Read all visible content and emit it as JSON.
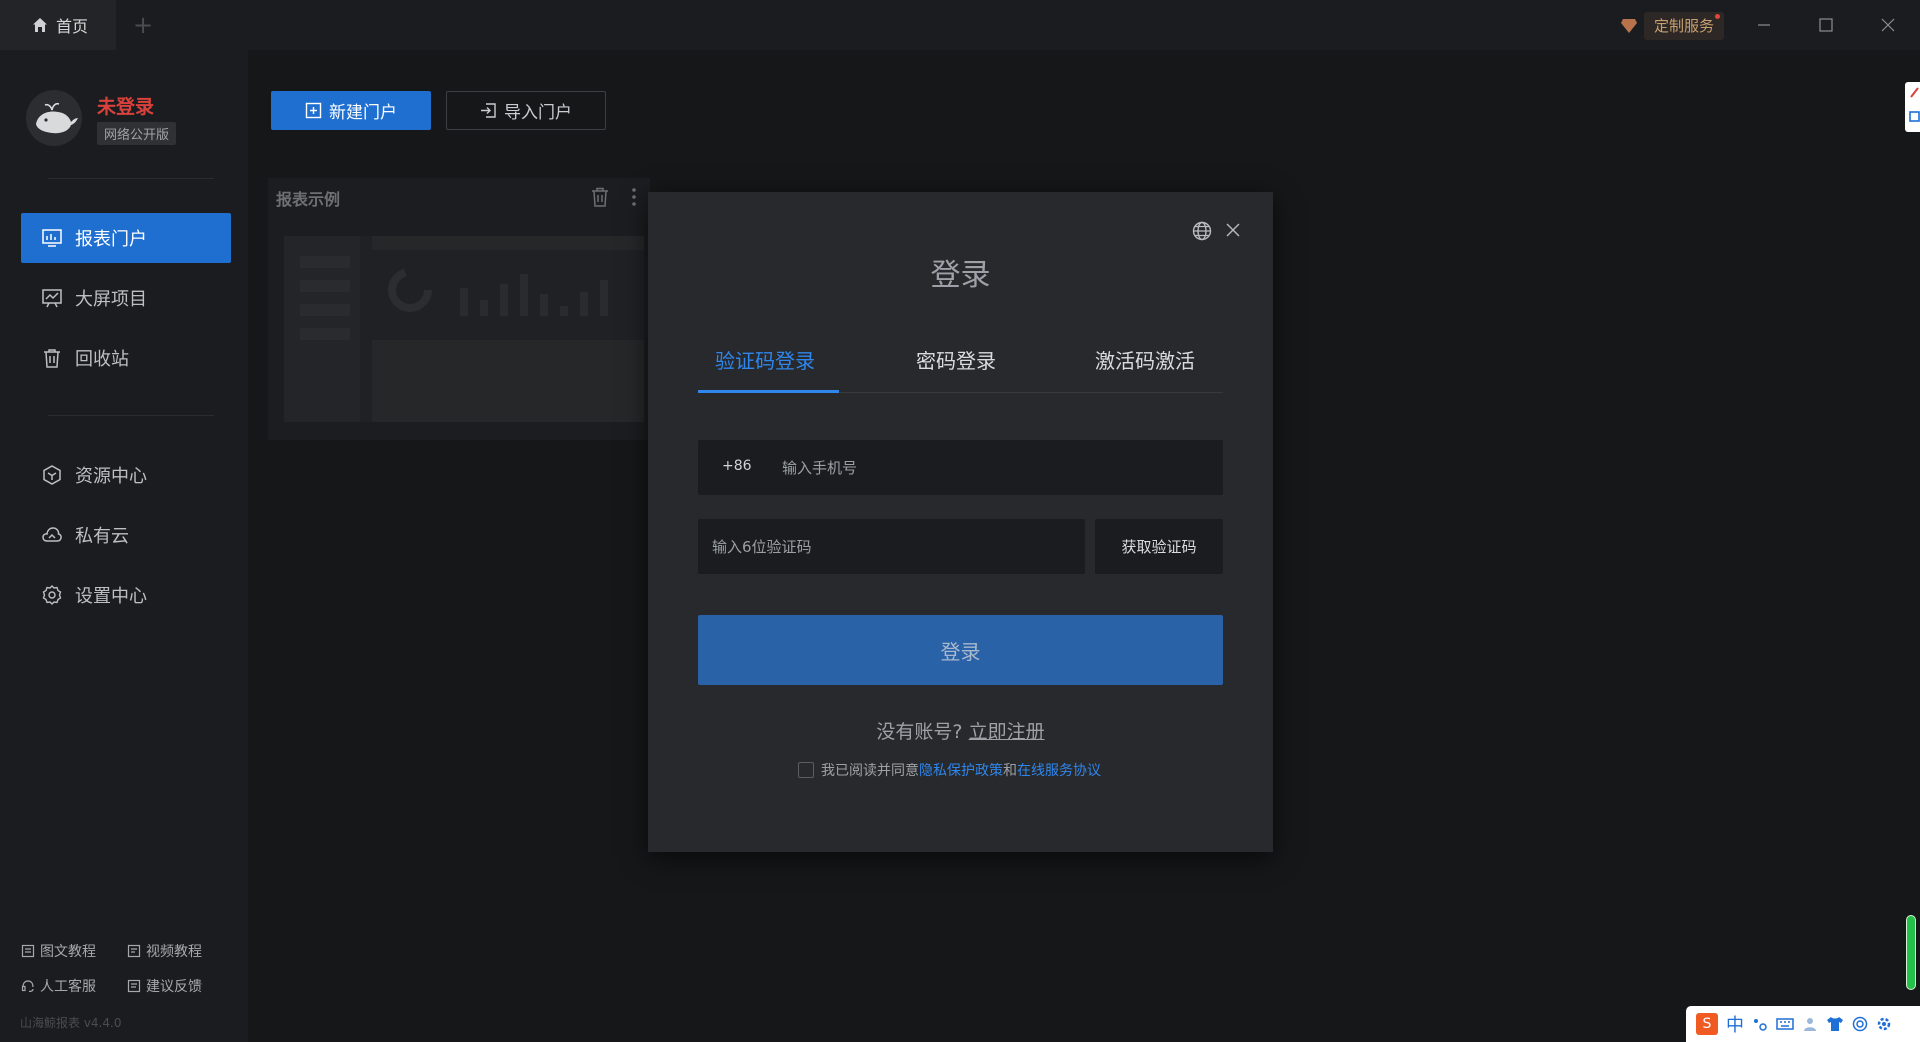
{
  "titlebar": {
    "home_tab": "首页",
    "add_tab": "+",
    "custom_service": "定制服务"
  },
  "user": {
    "name": "未登录",
    "edition": "网络公开版"
  },
  "sidebar": {
    "items": [
      {
        "label": "报表门户",
        "icon": "report-portal-icon",
        "active": true
      },
      {
        "label": "大屏项目",
        "icon": "dashboard-screen-icon",
        "active": false
      },
      {
        "label": "回收站",
        "icon": "trash-icon",
        "active": false
      },
      {
        "label": "资源中心",
        "icon": "resource-cube-icon",
        "active": false
      },
      {
        "label": "私有云",
        "icon": "cloud-icon",
        "active": false
      },
      {
        "label": "设置中心",
        "icon": "gear-icon",
        "active": false
      }
    ],
    "footer": {
      "graphic_tutorial": "图文教程",
      "video_tutorial": "视频教程",
      "support": "人工客服",
      "feedback": "建议反馈",
      "version": "山海鲸报表 v4.4.0"
    }
  },
  "toolbar": {
    "new_portal": "新建门户",
    "import_portal": "导入门户"
  },
  "card": {
    "title": "报表示例"
  },
  "login": {
    "title": "登录",
    "tabs": [
      "验证码登录",
      "密码登录",
      "激活码激活"
    ],
    "active_tab": 0,
    "country_code": "+86",
    "phone_placeholder": "输入手机号",
    "code_placeholder": "输入6位验证码",
    "get_code": "获取验证码",
    "submit": "登录",
    "no_account": "没有账号?",
    "register": "立即注册",
    "agree_prefix": "我已阅读并同意",
    "privacy_policy": "隐私保护政策",
    "and": "和",
    "service_agreement": "在线服务协议"
  },
  "ime": {
    "mode": "中"
  },
  "colors": {
    "accent": "#1f6fd1",
    "link": "#2f86ec",
    "username": "#d9423c",
    "login_button": "#2a62a8"
  }
}
